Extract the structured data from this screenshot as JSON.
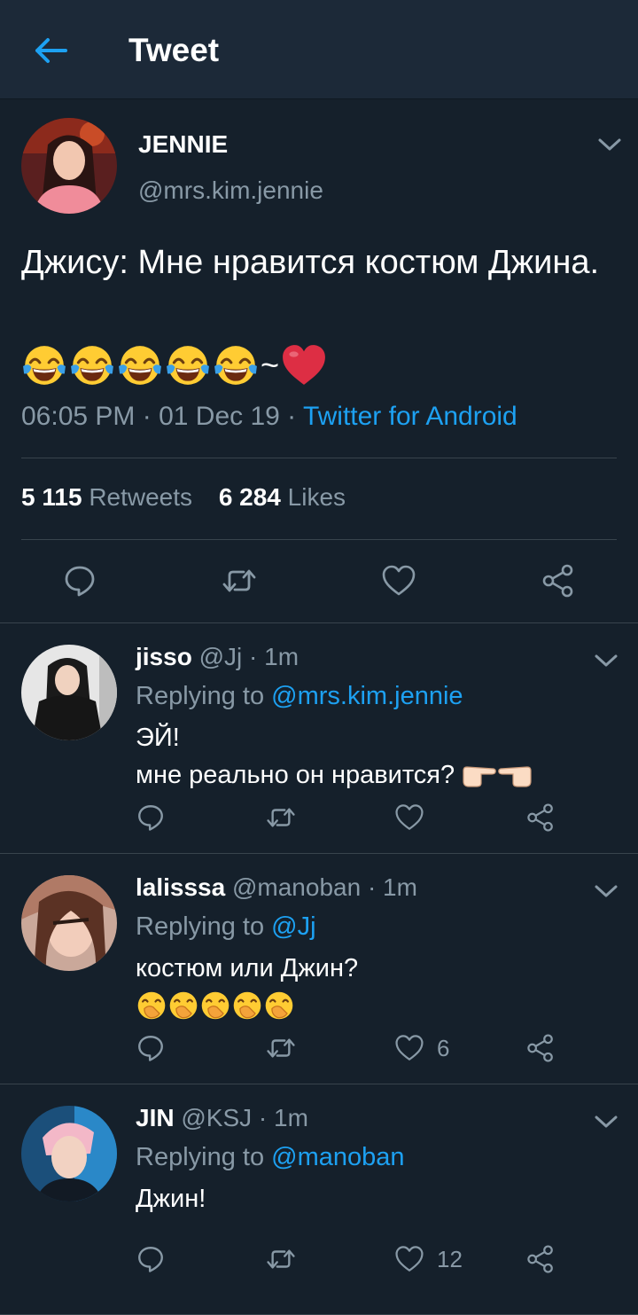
{
  "header": {
    "title": "Tweet"
  },
  "main_tweet": {
    "name": "JENNIE",
    "handle": "@mrs.kim.jennie",
    "text": "Джису: Мне нравится костюм Джина.",
    "emoji_tail": "~",
    "time": "06:05 PM · 01 Dec 19 · ",
    "source": "Twitter for Android",
    "retweets_count": "5 115",
    "retweets_label": "Retweets",
    "likes_count": "6 284",
    "likes_label": "Likes"
  },
  "replies": [
    {
      "name": "jisso",
      "handle": "@Jj",
      "time": "· 1m",
      "replying_prefix": "Replying to ",
      "replying_to": "@mrs.kim.jennie",
      "line1": "ЭЙ!",
      "line2": "мне реально он нравится?",
      "like_count": ""
    },
    {
      "name": "lalisssa",
      "handle": "@manoban",
      "time": "· 1m",
      "replying_prefix": "Replying to ",
      "replying_to": "@Jj",
      "line1": "костюм или Джин?",
      "like_count": "6"
    },
    {
      "name": "JIN",
      "handle": "@KSJ",
      "time": "· 1m",
      "replying_prefix": "Replying to ",
      "replying_to": "@manoban",
      "line1": "Джин!",
      "like_count": "12"
    }
  ],
  "icons": {
    "back": "arrow-left-icon",
    "more": "chevron-down-icon",
    "reply": "comment-icon",
    "retweet": "retweet-icon",
    "like": "heart-icon",
    "share": "share-icon",
    "laugh": "tears-of-joy-emoji",
    "heart": "red-heart-emoji",
    "point": "pointing-fingers-emoji",
    "giggle": "hand-over-mouth-emoji"
  },
  "colors": {
    "background": "#15202b",
    "header_bg": "#1c2938",
    "accent": "#1da1f2",
    "secondary_text": "#8899a6",
    "divider": "#38444d"
  }
}
